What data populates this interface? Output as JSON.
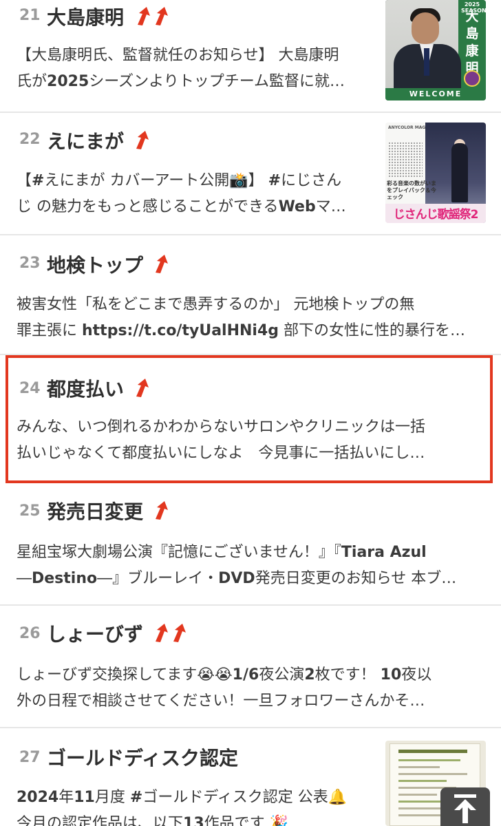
{
  "items": [
    {
      "rank": "21",
      "title": "大島康明",
      "arrows": 2,
      "lines": [
        "【大島康明氏、監督就任のお知らせ】 大島康明",
        "氏が<b>2025</b>シーズンよりトップチーム監督に就…"
      ],
      "thumbnail": {
        "name_vertical": [
          "大",
          "島",
          "康",
          "明"
        ],
        "season": "2025 SEASON",
        "caption": "WELCOME"
      }
    },
    {
      "rank": "22",
      "title": "えにまが",
      "arrows": 1,
      "lines": [
        "【<b>#</b>えにまが カバーアート公開📸】 <b>#</b>にじさん",
        "じ の魅力をもっと感じることができる<b>Web</b>マ…"
      ],
      "thumbnail": {
        "header": "ANYCOLOR MAGAZINE",
        "caption": "彩る音楽の数がいま\nをプレイバック＆今\nェック",
        "banner": "じさんじ歌謡祭2"
      }
    },
    {
      "rank": "23",
      "title": "地検トップ",
      "arrows": 1,
      "lines": [
        "被害女性「私をどこまで愚弄するのか」 元地検トップの無",
        "罪主張に <b>https://t.co/tyUalHNi4g</b> 部下の女性に性的暴行を…"
      ]
    },
    {
      "rank": "24",
      "title": "都度払い",
      "arrows": 1,
      "lines": [
        "みんな、いつ倒れるかわからないサロンやクリニックは一括",
        "払いじゃなくて都度払いにしなよ　今見事に一括払いにし…"
      ]
    },
    {
      "rank": "25",
      "title": "発売日変更",
      "arrows": 1,
      "lines": [
        "星組宝塚大劇場公演『記憶にございません！』『<b>Tiara Azul</b>",
        "―<b>Destino</b>―』ブルーレイ・<b>DVD</b>発売日変更のお知らせ 本ブ…"
      ]
    },
    {
      "rank": "26",
      "title": "しょーびず",
      "arrows": 2,
      "lines": [
        "しょーびず交換探してます😭😭<b>1/6</b>夜公演<b>2</b>枚です！ <b>10</b>夜以",
        "外の日程で相談させてください！一旦フォロワーさんかそ…"
      ]
    },
    {
      "rank": "27",
      "title": "ゴールドディスク認定",
      "arrows": 0,
      "lines": [
        "<b>2024</b>年<b>11</b>月度 <b>#</b>ゴールドディスク認定 公表🔔",
        "今月の認定作品は、以下<b>13</b>作品です 🎉"
      ]
    }
  ],
  "colors": {
    "arrow": "#e2371f",
    "highlight_border": "#e2371f",
    "rank": "#9a9a9a",
    "title": "#2f2f2f",
    "divider": "#e6e6e6"
  },
  "icons": {
    "trend_arrow": "up-right-arrow-icon",
    "scroll_top": "arrow-up-icon"
  },
  "highlighted_rank": "24"
}
